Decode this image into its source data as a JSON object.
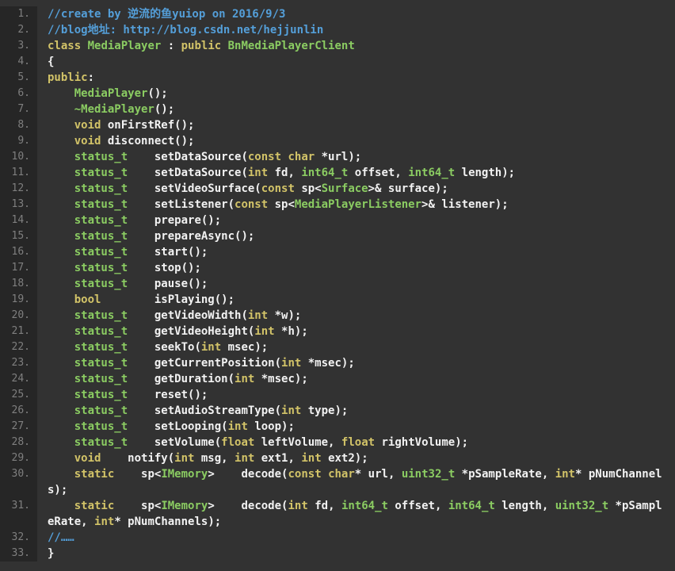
{
  "editor": {
    "colors": {
      "background": "#323232",
      "gutter_bg": "#262626",
      "gutter_text": "#7f7f7f",
      "plain": "#f2f2f2",
      "keyword": "#d2c368",
      "type": "#8bcc62",
      "comment": "#549fd9"
    },
    "token_classes": {
      "p": "plain",
      "k": "keyword",
      "t": "type",
      "c": "comment"
    },
    "rows": [
      {
        "num": "1.",
        "tokens": [
          [
            "c",
            "//create by 逆流的鱼yuiop on 2016/9/3"
          ]
        ]
      },
      {
        "num": "2.",
        "tokens": [
          [
            "c",
            "//blog地址: http://blog.csdn.net/hejjunlin"
          ]
        ]
      },
      {
        "num": "3.",
        "tokens": [
          [
            "k",
            "class"
          ],
          [
            "p",
            " "
          ],
          [
            "t",
            "MediaPlayer"
          ],
          [
            "p",
            " : "
          ],
          [
            "k",
            "public"
          ],
          [
            "p",
            " "
          ],
          [
            "t",
            "BnMediaPlayerClient"
          ]
        ]
      },
      {
        "num": "4.",
        "tokens": [
          [
            "p",
            "{"
          ]
        ]
      },
      {
        "num": "5.",
        "tokens": [
          [
            "k",
            "public"
          ],
          [
            "p",
            ":"
          ]
        ]
      },
      {
        "num": "6.",
        "tokens": [
          [
            "p",
            "    "
          ],
          [
            "t",
            "MediaPlayer"
          ],
          [
            "p",
            "();"
          ]
        ]
      },
      {
        "num": "7.",
        "tokens": [
          [
            "p",
            "    "
          ],
          [
            "t",
            "~MediaPlayer"
          ],
          [
            "p",
            "();"
          ]
        ]
      },
      {
        "num": "8.",
        "tokens": [
          [
            "p",
            "    "
          ],
          [
            "k",
            "void"
          ],
          [
            "p",
            " onFirstRef();"
          ]
        ]
      },
      {
        "num": "9.",
        "tokens": [
          [
            "p",
            "    "
          ],
          [
            "k",
            "void"
          ],
          [
            "p",
            " disconnect();"
          ]
        ]
      },
      {
        "num": "10.",
        "tokens": [
          [
            "p",
            "    "
          ],
          [
            "t",
            "status_t"
          ],
          [
            "p",
            "    setDataSource("
          ],
          [
            "k",
            "const"
          ],
          [
            "p",
            " "
          ],
          [
            "k",
            "char"
          ],
          [
            "p",
            " *url);"
          ]
        ]
      },
      {
        "num": "11.",
        "tokens": [
          [
            "p",
            "    "
          ],
          [
            "t",
            "status_t"
          ],
          [
            "p",
            "    setDataSource("
          ],
          [
            "k",
            "int"
          ],
          [
            "p",
            " fd, "
          ],
          [
            "t",
            "int64_t"
          ],
          [
            "p",
            " offset, "
          ],
          [
            "t",
            "int64_t"
          ],
          [
            "p",
            " length);"
          ]
        ]
      },
      {
        "num": "12.",
        "tokens": [
          [
            "p",
            "    "
          ],
          [
            "t",
            "status_t"
          ],
          [
            "p",
            "    setVideoSurface("
          ],
          [
            "k",
            "const"
          ],
          [
            "p",
            " sp<"
          ],
          [
            "t",
            "Surface"
          ],
          [
            "p",
            ">& surface);"
          ]
        ]
      },
      {
        "num": "13.",
        "tokens": [
          [
            "p",
            "    "
          ],
          [
            "t",
            "status_t"
          ],
          [
            "p",
            "    setListener("
          ],
          [
            "k",
            "const"
          ],
          [
            "p",
            " sp<"
          ],
          [
            "t",
            "MediaPlayerListener"
          ],
          [
            "p",
            ">& listener);"
          ]
        ]
      },
      {
        "num": "14.",
        "tokens": [
          [
            "p",
            "    "
          ],
          [
            "t",
            "status_t"
          ],
          [
            "p",
            "    prepare();"
          ]
        ]
      },
      {
        "num": "15.",
        "tokens": [
          [
            "p",
            "    "
          ],
          [
            "t",
            "status_t"
          ],
          [
            "p",
            "    prepareAsync();"
          ]
        ]
      },
      {
        "num": "16.",
        "tokens": [
          [
            "p",
            "    "
          ],
          [
            "t",
            "status_t"
          ],
          [
            "p",
            "    start();"
          ]
        ]
      },
      {
        "num": "17.",
        "tokens": [
          [
            "p",
            "    "
          ],
          [
            "t",
            "status_t"
          ],
          [
            "p",
            "    stop();"
          ]
        ]
      },
      {
        "num": "18.",
        "tokens": [
          [
            "p",
            "    "
          ],
          [
            "t",
            "status_t"
          ],
          [
            "p",
            "    pause();"
          ]
        ]
      },
      {
        "num": "19.",
        "tokens": [
          [
            "p",
            "    "
          ],
          [
            "k",
            "bool"
          ],
          [
            "p",
            "        isPlaying();"
          ]
        ]
      },
      {
        "num": "20.",
        "tokens": [
          [
            "p",
            "    "
          ],
          [
            "t",
            "status_t"
          ],
          [
            "p",
            "    getVideoWidth("
          ],
          [
            "k",
            "int"
          ],
          [
            "p",
            " *w);"
          ]
        ]
      },
      {
        "num": "21.",
        "tokens": [
          [
            "p",
            "    "
          ],
          [
            "t",
            "status_t"
          ],
          [
            "p",
            "    getVideoHeight("
          ],
          [
            "k",
            "int"
          ],
          [
            "p",
            " *h);"
          ]
        ]
      },
      {
        "num": "22.",
        "tokens": [
          [
            "p",
            "    "
          ],
          [
            "t",
            "status_t"
          ],
          [
            "p",
            "    seekTo("
          ],
          [
            "k",
            "int"
          ],
          [
            "p",
            " msec);"
          ]
        ]
      },
      {
        "num": "23.",
        "tokens": [
          [
            "p",
            "    "
          ],
          [
            "t",
            "status_t"
          ],
          [
            "p",
            "    getCurrentPosition("
          ],
          [
            "k",
            "int"
          ],
          [
            "p",
            " *msec);"
          ]
        ]
      },
      {
        "num": "24.",
        "tokens": [
          [
            "p",
            "    "
          ],
          [
            "t",
            "status_t"
          ],
          [
            "p",
            "    getDuration("
          ],
          [
            "k",
            "int"
          ],
          [
            "p",
            " *msec);"
          ]
        ]
      },
      {
        "num": "25.",
        "tokens": [
          [
            "p",
            "    "
          ],
          [
            "t",
            "status_t"
          ],
          [
            "p",
            "    reset();"
          ]
        ]
      },
      {
        "num": "26.",
        "tokens": [
          [
            "p",
            "    "
          ],
          [
            "t",
            "status_t"
          ],
          [
            "p",
            "    setAudioStreamType("
          ],
          [
            "k",
            "int"
          ],
          [
            "p",
            " type);"
          ]
        ]
      },
      {
        "num": "27.",
        "tokens": [
          [
            "p",
            "    "
          ],
          [
            "t",
            "status_t"
          ],
          [
            "p",
            "    setLooping("
          ],
          [
            "k",
            "int"
          ],
          [
            "p",
            " loop);"
          ]
        ]
      },
      {
        "num": "28.",
        "tokens": [
          [
            "p",
            "    "
          ],
          [
            "t",
            "status_t"
          ],
          [
            "p",
            "    setVolume("
          ],
          [
            "k",
            "float"
          ],
          [
            "p",
            " leftVolume, "
          ],
          [
            "k",
            "float"
          ],
          [
            "p",
            " rightVolume);"
          ]
        ]
      },
      {
        "num": "29.",
        "tokens": [
          [
            "p",
            "    "
          ],
          [
            "k",
            "void"
          ],
          [
            "p",
            "    notify("
          ],
          [
            "k",
            "int"
          ],
          [
            "p",
            " msg, "
          ],
          [
            "k",
            "int"
          ],
          [
            "p",
            " ext1, "
          ],
          [
            "k",
            "int"
          ],
          [
            "p",
            " ext2);"
          ]
        ]
      },
      {
        "num": "30.",
        "tokens": [
          [
            "p",
            "    "
          ],
          [
            "k",
            "static"
          ],
          [
            "p",
            "    sp<"
          ],
          [
            "t",
            "IMemory"
          ],
          [
            "p",
            ">    decode("
          ],
          [
            "k",
            "const"
          ],
          [
            "p",
            " "
          ],
          [
            "k",
            "char"
          ],
          [
            "p",
            "* url, "
          ],
          [
            "t",
            "uint32_t"
          ],
          [
            "p",
            " *pSampleRate, "
          ],
          [
            "k",
            "int"
          ],
          [
            "p",
            "* pNumChannel"
          ]
        ]
      },
      {
        "num": "",
        "tokens": [
          [
            "p",
            "s);"
          ]
        ]
      },
      {
        "num": "31.",
        "tokens": [
          [
            "p",
            "    "
          ],
          [
            "k",
            "static"
          ],
          [
            "p",
            "    sp<"
          ],
          [
            "t",
            "IMemory"
          ],
          [
            "p",
            ">    decode("
          ],
          [
            "k",
            "int"
          ],
          [
            "p",
            " fd, "
          ],
          [
            "t",
            "int64_t"
          ],
          [
            "p",
            " offset, "
          ],
          [
            "t",
            "int64_t"
          ],
          [
            "p",
            " length, "
          ],
          [
            "t",
            "uint32_t"
          ],
          [
            "p",
            " *pSampl"
          ]
        ]
      },
      {
        "num": "",
        "tokens": [
          [
            "p",
            "eRate, "
          ],
          [
            "k",
            "int"
          ],
          [
            "p",
            "* pNumChannels);"
          ]
        ]
      },
      {
        "num": "32.",
        "tokens": [
          [
            "c",
            "//……"
          ]
        ]
      },
      {
        "num": "33.",
        "tokens": [
          [
            "p",
            "}"
          ]
        ]
      }
    ]
  }
}
